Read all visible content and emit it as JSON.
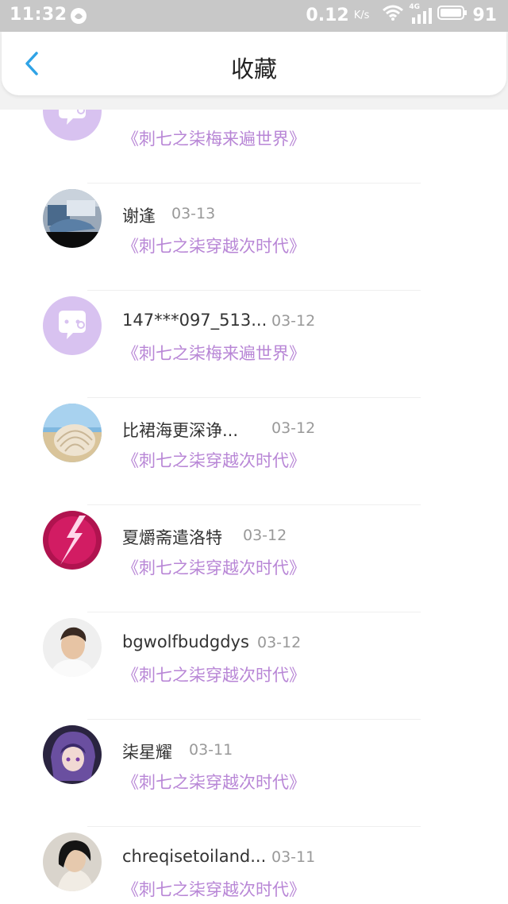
{
  "status_bar": {
    "time": "11:32",
    "speed_value": "0.12",
    "speed_unit": "K/s",
    "network": "4G",
    "battery": "91"
  },
  "header": {
    "title": "收藏"
  },
  "favorites": [
    {
      "name": "",
      "date": "",
      "book": "《刺七之柒梅来遍世界》",
      "avatar": "chat-bubble"
    },
    {
      "name": "谢逢",
      "date": "03-13",
      "book": "《刺七之柒穿越次时代》",
      "avatar": "anime-room"
    },
    {
      "name": "147***097_513...",
      "date": "03-12",
      "book": "《刺七之柒梅来遍世界》",
      "avatar": "chat-bubble"
    },
    {
      "name": "比裙海更深诤...",
      "date": "03-12",
      "book": "《刺七之柒穿越次时代》",
      "avatar": "seashell"
    },
    {
      "name": "夏爝斋遣洛特",
      "date": "03-12",
      "book": "《刺七之柒穿越次时代》",
      "avatar": "lightning"
    },
    {
      "name": "bgwolfbudgdys",
      "date": "03-12",
      "book": "《刺七之柒穿越次时代》",
      "avatar": "portrait-man"
    },
    {
      "name": "柒星耀",
      "date": "03-11",
      "book": "《刺七之柒穿越次时代》",
      "avatar": "anime-character"
    },
    {
      "name": "chreqisetoiland...",
      "date": "03-11",
      "book": "《刺七之柒穿越次时代》",
      "avatar": "dark-hair-person"
    }
  ],
  "colors": {
    "accent_blue": "#2fa3e6",
    "book_title": "#b886d6",
    "date": "#999999",
    "placeholder_avatar": "#d8c2f0"
  }
}
